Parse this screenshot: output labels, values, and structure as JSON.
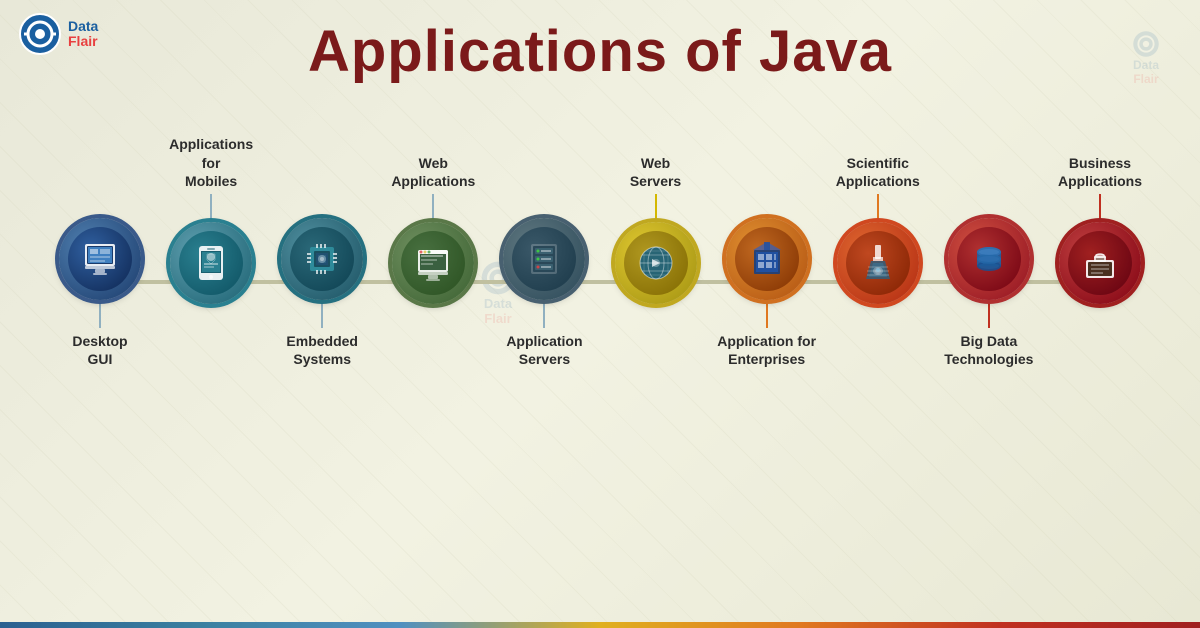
{
  "title": "Applications of Java",
  "logo": {
    "text_line1": "Data",
    "text_line2": "Flair"
  },
  "nodes": [
    {
      "id": "desktop-gui",
      "label_position": "below",
      "label": "Desktop\nGUI",
      "icon": "🖥",
      "color_class": "c-blue-dark",
      "line_color": ""
    },
    {
      "id": "mobile-apps",
      "label_position": "above",
      "label": "Applications for\nMobiles",
      "icon": "📱",
      "color_class": "c-teal",
      "line_color": ""
    },
    {
      "id": "embedded",
      "label_position": "below",
      "label": "Embedded\nSystems",
      "icon": "🔲",
      "color_class": "c-green-blue",
      "line_color": ""
    },
    {
      "id": "web-apps",
      "label_position": "above",
      "label": "Web\nApplications",
      "icon": "🖥",
      "color_class": "c-olive",
      "line_color": ""
    },
    {
      "id": "app-servers",
      "label_position": "below",
      "label": "Application\nServers",
      "icon": "🗄",
      "color_class": "c-gray-blue",
      "line_color": ""
    },
    {
      "id": "web-servers",
      "label_position": "above",
      "label": "Web\nServers",
      "icon": "🌐",
      "color_class": "c-yellow",
      "line_color": "yellow"
    },
    {
      "id": "enterprises",
      "label_position": "below",
      "label": "Application for\nEnterprises",
      "icon": "🏢",
      "color_class": "c-orange",
      "line_color": "orange"
    },
    {
      "id": "scientific",
      "label_position": "above",
      "label": "Scientific\nApplications",
      "icon": "🔬",
      "color_class": "c-orange-red",
      "line_color": "orange"
    },
    {
      "id": "big-data",
      "label_position": "below",
      "label": "Big Data\nTechnologies",
      "icon": "💾",
      "color_class": "c-red",
      "line_color": "red"
    },
    {
      "id": "business",
      "label_position": "above",
      "label": "Business\nApplications",
      "icon": "💼",
      "color_class": "c-dark-red",
      "line_color": "red"
    }
  ]
}
